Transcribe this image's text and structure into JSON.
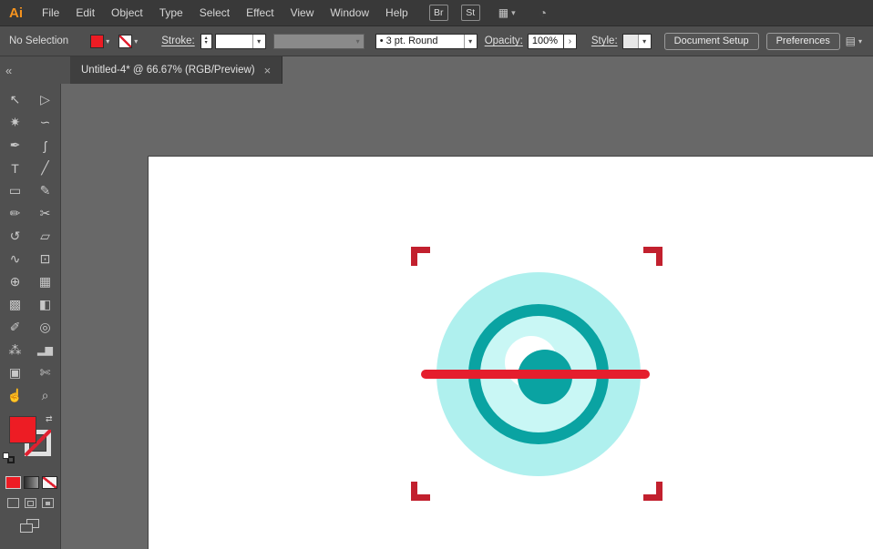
{
  "menubar": {
    "logo": "Ai",
    "items": [
      "File",
      "Edit",
      "Object",
      "Type",
      "Select",
      "Effect",
      "View",
      "Window",
      "Help"
    ],
    "bridge_button": "Br",
    "stock_button": "St"
  },
  "controlbar": {
    "no_selection_label": "No Selection",
    "stroke_label": "Stroke:",
    "brush_name": "3 pt. Round",
    "opacity_label": "Opacity:",
    "opacity_value": "100%",
    "style_label": "Style:",
    "document_setup_button": "Document Setup",
    "preferences_button": "Preferences"
  },
  "tabbar": {
    "tab_title": "Untitled-4* @ 66.67% (RGB/Preview)"
  },
  "glyphs": {
    "chevron_down": "▾",
    "chevron_up": "▴",
    "chevron_right": "›",
    "bullet": "•",
    "swap": "⇄",
    "collapse": "«",
    "close": "×",
    "workspace_grid": "▦",
    "cs_live": "◔",
    "panel_menu": "▤"
  },
  "toolbar": {
    "tools": [
      {
        "name": "selection-tool",
        "glyph": "↖"
      },
      {
        "name": "direct-selection-tool",
        "glyph": "▷"
      },
      {
        "name": "magic-wand-tool",
        "glyph": "✷"
      },
      {
        "name": "lasso-tool",
        "glyph": "∽"
      },
      {
        "name": "pen-tool",
        "glyph": "✒"
      },
      {
        "name": "curvature-tool",
        "glyph": "ʃ"
      },
      {
        "name": "type-tool",
        "glyph": "T"
      },
      {
        "name": "line-segment-tool",
        "glyph": "╱"
      },
      {
        "name": "rectangle-tool",
        "glyph": "▭"
      },
      {
        "name": "paintbrush-tool",
        "glyph": "✎"
      },
      {
        "name": "pencil-tool",
        "glyph": "✏"
      },
      {
        "name": "scissors-tool",
        "glyph": "✂"
      },
      {
        "name": "rotate-tool",
        "glyph": "↺"
      },
      {
        "name": "scale-tool",
        "glyph": "▱"
      },
      {
        "name": "width-tool",
        "glyph": "∿"
      },
      {
        "name": "free-transform-tool",
        "glyph": "⊡"
      },
      {
        "name": "shape-builder-tool",
        "glyph": "⊕"
      },
      {
        "name": "perspective-grid-tool",
        "glyph": "▦"
      },
      {
        "name": "mesh-tool",
        "glyph": "▩"
      },
      {
        "name": "gradient-tool",
        "glyph": "◧"
      },
      {
        "name": "eyedropper-tool",
        "glyph": "✐"
      },
      {
        "name": "blend-tool",
        "glyph": "◎"
      },
      {
        "name": "symbol-sprayer-tool",
        "glyph": "⁂"
      },
      {
        "name": "column-graph-tool",
        "glyph": "▂▆"
      },
      {
        "name": "artboard-tool",
        "glyph": "▣"
      },
      {
        "name": "slice-tool",
        "glyph": "✄"
      },
      {
        "name": "hand-tool",
        "glyph": "☝"
      },
      {
        "name": "zoom-tool",
        "glyph": "⌕"
      }
    ]
  },
  "canvas": {
    "colors": {
      "pasteboard": "#686868",
      "artboard": "#ffffff",
      "eye_outer": "#aff0ee",
      "eye_inner": "#c9f7f5",
      "eye_teal": "#0aa3a2",
      "eye_highlight": "#ffffff",
      "scan_line_red": "#e51e2d",
      "corner_mark_red": "#c2202e",
      "fill_red": "#ed1c24"
    }
  }
}
